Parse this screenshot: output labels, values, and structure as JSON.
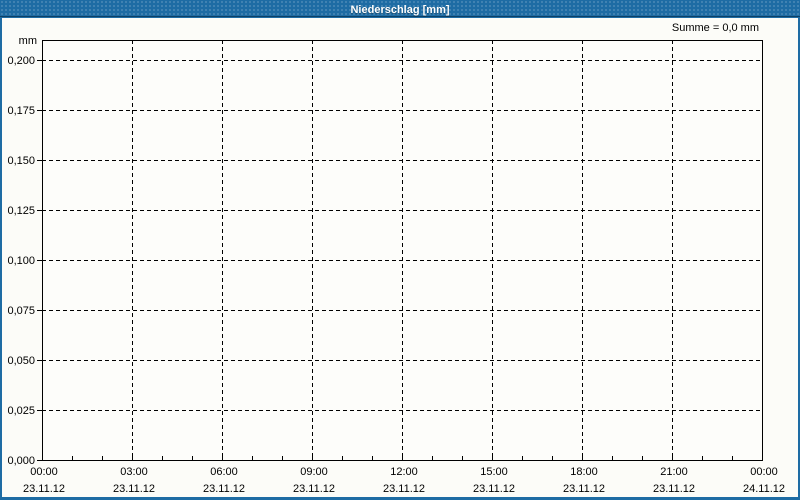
{
  "window": {
    "title": "Niederschlag [mm]"
  },
  "colors": {
    "frame": "#1e6ca4",
    "titlebar_text": "#ffffff",
    "titlebar_divider": "#0d4066",
    "content_background": "#fcfcf8",
    "plot_background": "#fdfdfa",
    "grid_line": "#000000",
    "axis_line": "#000000",
    "label_text": "#000000"
  },
  "chart_data": {
    "type": "line",
    "title": "Niederschlag [mm]",
    "sum_label": "Summe = 0,0 mm",
    "grid": "dashed",
    "legend": "none",
    "y_axis": {
      "unit_label": "mm",
      "min": 0,
      "max": 0.2,
      "tick_step": 0.025,
      "tick_labels": [
        "0,000",
        "0,025",
        "0,050",
        "0,075",
        "0,100",
        "0,125",
        "0,150",
        "0,175",
        "0,200"
      ],
      "decimal_separator": ","
    },
    "x_axis": {
      "total_hours": 24,
      "minor_tick_hours": 1,
      "major_tick_hours": 3,
      "major_ticks": [
        {
          "time": "00:00",
          "date": "23.11.12"
        },
        {
          "time": "03:00",
          "date": "23.11.12"
        },
        {
          "time": "06:00",
          "date": "23.11.12"
        },
        {
          "time": "09:00",
          "date": "23.11.12"
        },
        {
          "time": "12:00",
          "date": "23.11.12"
        },
        {
          "time": "15:00",
          "date": "23.11.12"
        },
        {
          "time": "18:00",
          "date": "23.11.12"
        },
        {
          "time": "21:00",
          "date": "23.11.12"
        },
        {
          "time": "00:00",
          "date": "24.11.12"
        }
      ]
    },
    "series": [
      {
        "name": "Niederschlag",
        "values": [],
        "note": "no precipitation trace visible; displayed sum is 0,0 mm"
      }
    ]
  }
}
